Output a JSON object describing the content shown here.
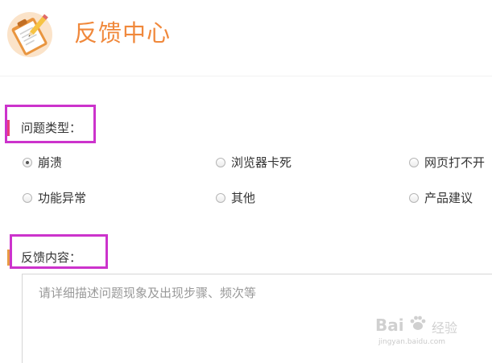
{
  "header": {
    "title": "反馈中心",
    "logo_icon": "clipboard-pencil-icon",
    "title_color": "#f0883b"
  },
  "problem_type": {
    "label": "问题类型：",
    "bar_color": "#e8407a",
    "options": [
      {
        "label": "崩溃",
        "checked": true
      },
      {
        "label": "浏览器卡死",
        "checked": false
      },
      {
        "label": "网页打不开",
        "checked": false
      },
      {
        "label": "功能异常",
        "checked": false
      },
      {
        "label": "其他",
        "checked": false
      },
      {
        "label": "产品建议",
        "checked": false
      }
    ]
  },
  "feedback_content": {
    "label": "反馈内容：",
    "bar_color": "#e89a45",
    "placeholder": "请详细描述问题现象及出现步骤、频次等",
    "value": ""
  },
  "annotation_color": "#cc33cc",
  "watermark": {
    "brand": "Bai",
    "brand_suffix": "经验",
    "url": "jingyan.baidu.com"
  }
}
